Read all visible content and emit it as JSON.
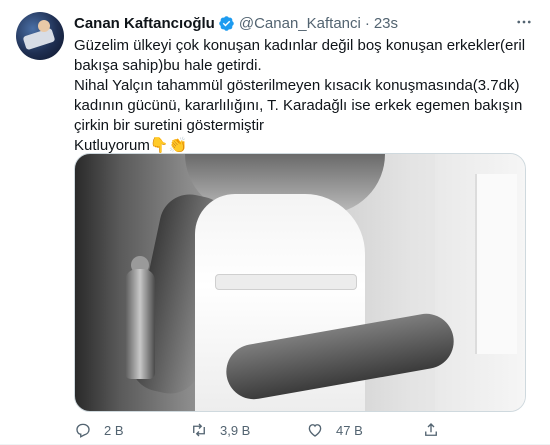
{
  "tweet": {
    "author_name": "Canan Kaftancıoğlu",
    "handle": "@Canan_Kaftanci",
    "separator": "·",
    "time": "23s",
    "lines": [
      "Güzelim ülkeyi çok konuşan kadınlar değil boş konuşan erkekler(eril bakışa sahip)bu hale getirdi.",
      "Nihal Yalçın tahammül gösterilmeyen kısacık konuşmasında(3.7dk)  kadının gücünü, kararlılığını, T. Karadağlı ise erkek egemen bakışın çirkin bir suretini göstermiştir",
      "Kutluyorum👇👏"
    ]
  },
  "actions": {
    "reply_count": "2 B",
    "retweet_count": "3,9 B",
    "like_count": "47 B"
  },
  "colors": {
    "text": "#0f1419",
    "secondary": "#536471",
    "verified": "#1d9bf0",
    "border": "#cfd9de"
  },
  "icons": [
    "verified-badge-icon",
    "more-icon",
    "reply-icon",
    "retweet-icon",
    "like-icon",
    "share-icon"
  ]
}
